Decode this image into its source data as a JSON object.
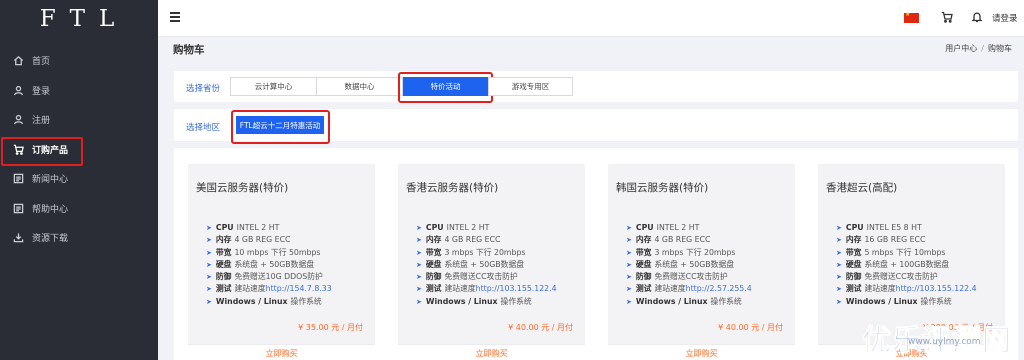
{
  "sidebar": {
    "logo": "FTL",
    "items": [
      {
        "label": "首页",
        "icon": "home-icon"
      },
      {
        "label": "登录",
        "icon": "user-icon"
      },
      {
        "label": "注册",
        "icon": "user-icon"
      },
      {
        "label": "订购产品",
        "icon": "cart-icon",
        "active": true
      },
      {
        "label": "新闻中心",
        "icon": "news-icon"
      },
      {
        "label": "帮助中心",
        "icon": "news-icon"
      },
      {
        "label": "资源下载",
        "icon": "download-icon"
      }
    ]
  },
  "topbar": {
    "login_label": "请登录",
    "flag": "china-flag-icon",
    "cart_icon": "cart-icon",
    "bell_icon": "bell-icon"
  },
  "page": {
    "title": "购物车",
    "breadcrumb": [
      "用户中心",
      "购物车"
    ]
  },
  "filters": {
    "region_group_label": "选择省份",
    "groups": [
      "云计算中心",
      "数据中心",
      "特价活动",
      "游戏专用区"
    ],
    "active_group": "特价活动",
    "region_label": "选择地区",
    "region_selected": "FTL超云十二月特惠活动"
  },
  "products": [
    {
      "name": "美国云服务器(特价)",
      "specs": [
        {
          "k": "CPU",
          "v": "INTEL 2 HT"
        },
        {
          "k": "内存",
          "v": "4 GB REG ECC"
        },
        {
          "k": "带宽",
          "v": "10 mbps 下行 50mbps"
        },
        {
          "k": "硬盘",
          "v": "系统盘 + 50GB数据盘"
        },
        {
          "k": "防御",
          "v": "免费赠送10G DDOS防护"
        },
        {
          "k": "测试",
          "v": "建站速度",
          "link": "http://154.7.8.33"
        },
        {
          "k": "Windows / Linux",
          "v": "操作系统"
        }
      ],
      "price": "¥ 35.00 元 / 月付",
      "buy": "立即购买"
    },
    {
      "name": "香港云服务器(特价)",
      "specs": [
        {
          "k": "CPU",
          "v": "INTEL 2 HT"
        },
        {
          "k": "内存",
          "v": "4 GB REG ECC"
        },
        {
          "k": "带宽",
          "v": "3 mbps 下行 20mbps"
        },
        {
          "k": "硬盘",
          "v": "系统盘 + 50GB数据盘"
        },
        {
          "k": "防御",
          "v": "免费赠送CC攻击防护"
        },
        {
          "k": "测试",
          "v": "建站速度",
          "link": "http://103.155.122.4"
        },
        {
          "k": "Windows / Linux",
          "v": "操作系统"
        }
      ],
      "price": "¥ 40.00 元 / 月付",
      "buy": "立即购买"
    },
    {
      "name": "韩国云服务器(特价)",
      "specs": [
        {
          "k": "CPU",
          "v": "INTEL 2 HT"
        },
        {
          "k": "内存",
          "v": "4 GB REG ECC"
        },
        {
          "k": "带宽",
          "v": "3 mbps 下行 20mbps"
        },
        {
          "k": "硬盘",
          "v": "系统盘 + 50GB数据盘"
        },
        {
          "k": "防御",
          "v": "免费赠送CC攻击防护"
        },
        {
          "k": "测试",
          "v": "建站速度",
          "link": "http://2.57.255.4"
        },
        {
          "k": "Windows / Linux",
          "v": "操作系统"
        }
      ],
      "price": "¥ 40.00 元 / 月付",
      "buy": "立即购买"
    },
    {
      "name": "香港超云(高配)",
      "specs": [
        {
          "k": "CPU",
          "v": "INTEL E5 8 HT"
        },
        {
          "k": "内存",
          "v": "16 GB REG ECC"
        },
        {
          "k": "带宽",
          "v": "5 mbps 下行 10mbps"
        },
        {
          "k": "硬盘",
          "v": "系统盘 + 100GB数据盘"
        },
        {
          "k": "防御",
          "v": "免费赠送CC攻击防护"
        },
        {
          "k": "测试",
          "v": "建站速度",
          "link": "http://103.155.122.4"
        },
        {
          "k": "Windows / Linux",
          "v": "操作系统"
        }
      ],
      "price": "¥ 280.00 元 / 月付",
      "buy": "立即购买"
    }
  ],
  "watermark": {
    "text": "优乐评测网",
    "sub": "www.uylmy.com"
  }
}
